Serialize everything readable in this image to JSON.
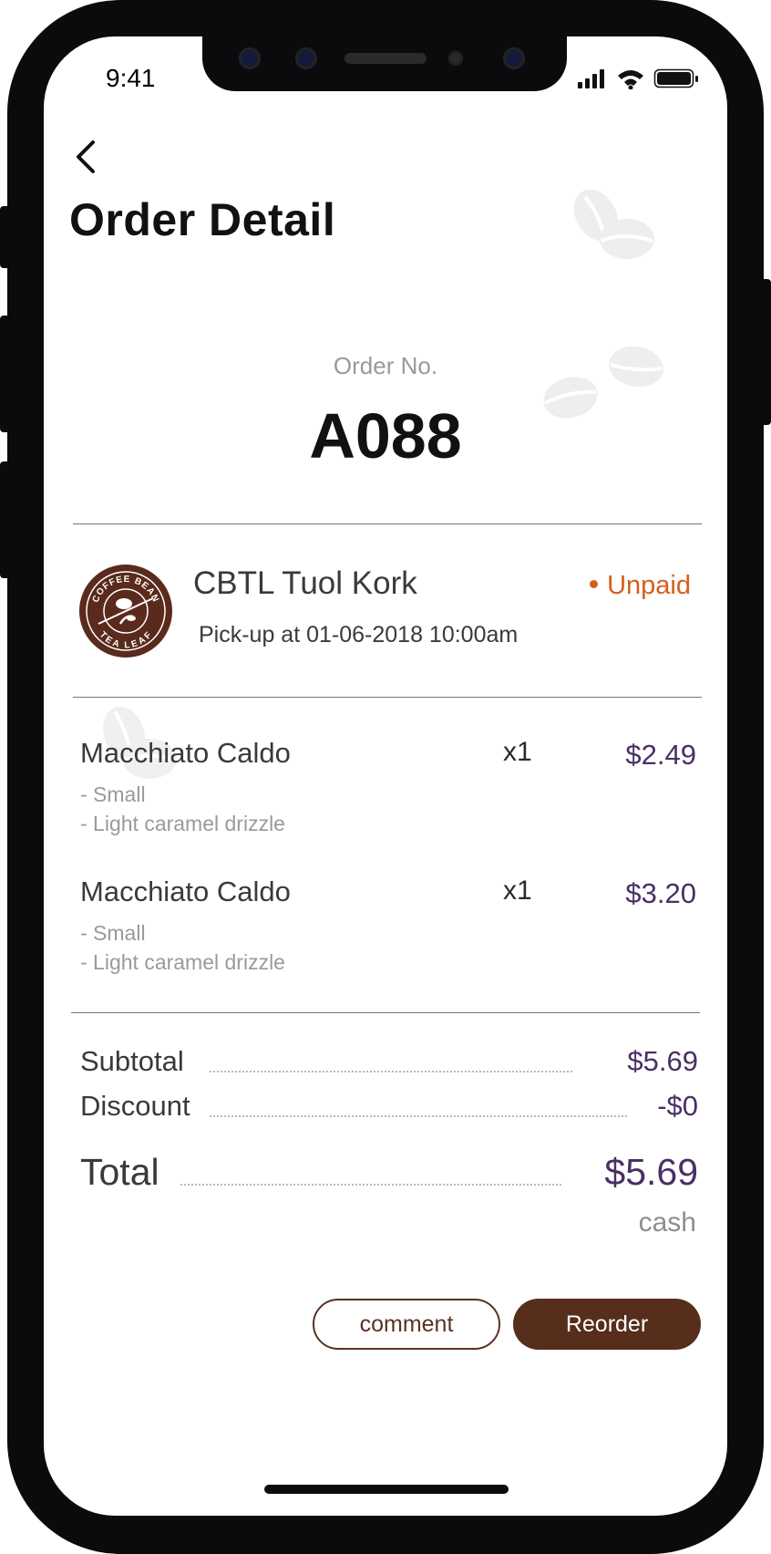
{
  "status_bar": {
    "time": "9:41"
  },
  "header": {
    "back_icon": "chevron-left-icon",
    "title": "Order Detail"
  },
  "order": {
    "label": "Order No.",
    "number": "A088"
  },
  "store": {
    "logo_icon": "coffee-bean-tea-leaf-logo",
    "logo_text_top": "COFFEE BEAN",
    "logo_text_bottom": "TEA LEAF",
    "name": "CBTL Tuol Kork",
    "status": "Unpaid",
    "pickup": "Pick-up at 01-06-2018 10:00am"
  },
  "items": [
    {
      "name": "Macchiato Caldo",
      "qty": "x1",
      "price": "$2.49",
      "options": [
        "- Small",
        "- Light caramel drizzle"
      ]
    },
    {
      "name": "Macchiato Caldo",
      "qty": "x1",
      "price": "$3.20",
      "options": [
        "- Small",
        "- Light caramel drizzle"
      ]
    }
  ],
  "summary": {
    "subtotal_label": "Subtotal",
    "subtotal_value": "$5.69",
    "discount_label": "Discount",
    "discount_value": "-$0",
    "total_label": "Total",
    "total_value": "$5.69",
    "payment_method": "cash"
  },
  "actions": {
    "comment_label": "comment",
    "reorder_label": "Reorder"
  },
  "colors": {
    "brand_brown": "#572d1c",
    "price_purple": "#4a2f66",
    "unpaid_orange": "#d55f1a"
  }
}
